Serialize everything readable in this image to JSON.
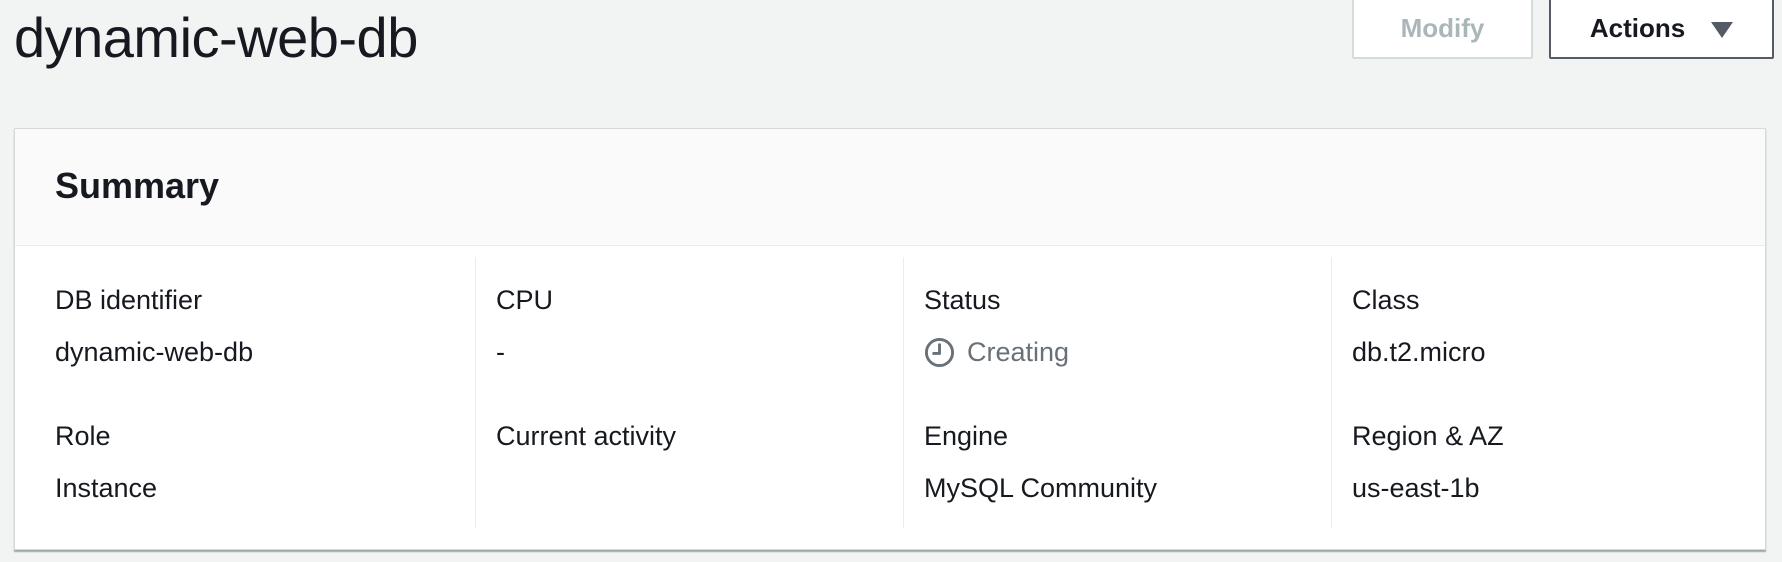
{
  "header": {
    "title": "dynamic-web-db",
    "modify_label": "Modify",
    "actions_label": "Actions"
  },
  "summary": {
    "title": "Summary",
    "columns": [
      {
        "fields": [
          {
            "label": "DB identifier",
            "value": "dynamic-web-db"
          },
          {
            "label": "Role",
            "value": "Instance"
          }
        ]
      },
      {
        "fields": [
          {
            "label": "CPU",
            "value": "-"
          },
          {
            "label": "Current activity",
            "value": ""
          }
        ]
      },
      {
        "fields": [
          {
            "label": "Status",
            "value": "Creating",
            "icon": "clock-icon"
          },
          {
            "label": "Engine",
            "value": "MySQL Community"
          }
        ]
      },
      {
        "fields": [
          {
            "label": "Class",
            "value": "db.t2.micro"
          },
          {
            "label": "Region & AZ",
            "value": "us-east-1b"
          }
        ]
      }
    ]
  },
  "colors": {
    "page_bg": "#f2f3f3",
    "text": "#16191f",
    "disabled_text": "#aab7b8",
    "status_pending": "#687078"
  }
}
